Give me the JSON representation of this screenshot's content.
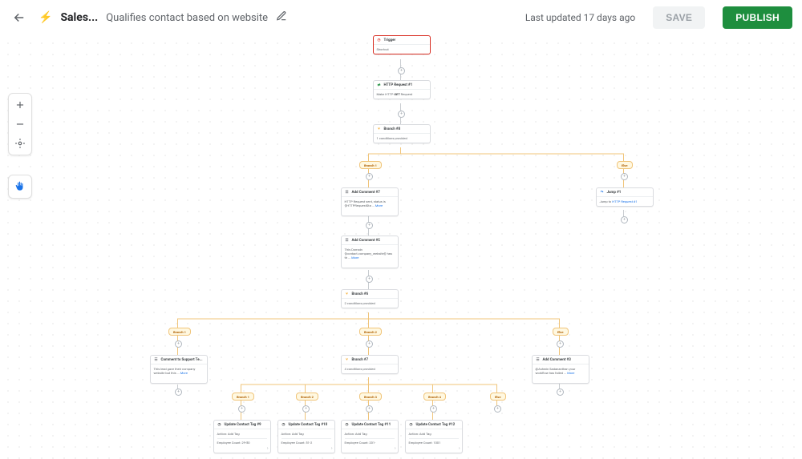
{
  "header": {
    "emoji": "⚡",
    "name": "Sales...",
    "subtitle": "Qualifies contact based on website",
    "updated": "Last updated 17 days ago",
    "save": "SAVE",
    "publish": "PUBLISH"
  },
  "nodes": {
    "trigger": {
      "icon": "◷",
      "title": "Trigger",
      "body": "Shortcut"
    },
    "http1": {
      "icon": "⇄",
      "title": "HTTP Request #1",
      "body_prefix": "Make HTTP ",
      "body_verb": "GET",
      "body_suffix": " Request"
    },
    "branch8": {
      "icon": "⑂",
      "title": "Branch #8",
      "body": "1 conditions provided"
    },
    "addc7": {
      "icon": "☰",
      "title": "Add Comment #7",
      "body": "HTTP Request sent, status is {{HTTPRequestSta ... ",
      "more": "More"
    },
    "addc5": {
      "icon": "☰",
      "title": "Add Comment #5",
      "body": "This Domain {{contact.company_website}} has th ... ",
      "more": "More"
    },
    "branch6": {
      "icon": "⑂",
      "title": "Branch #6",
      "body": "2 conditions provided"
    },
    "jump1": {
      "icon": "↷",
      "title": "Jump #1",
      "body_prefix": "Jump to ",
      "body_link": "HTTP Request #1"
    },
    "supportComment": {
      "icon": "☰",
      "title": "Comment to Support Te...",
      "body": "This lead gave their company website but this ... ",
      "more": "More"
    },
    "branch7": {
      "icon": "⑂",
      "title": "Branch #7",
      "body": "4 conditions provided"
    },
    "addc3": {
      "icon": "☰",
      "title": "Add Comment #3",
      "body": "@Ashwin Sadananthan your workflow has failed ... ",
      "more": "More"
    },
    "tag9": {
      "icon": "◷",
      "title": "Update Contact Tag #9",
      "action": "Action: Add Tag",
      "emp": "Employee Count: 29-50"
    },
    "tag10": {
      "icon": "◷",
      "title": "Update Contact Tag #10",
      "action": "Action: Add Tag",
      "emp": "Employee Count: 51-2"
    },
    "tag11": {
      "icon": "◷",
      "title": "Update Contact Tag #11",
      "action": "Action: Add Tag",
      "emp": "Employee Count: 201-"
    },
    "tag12": {
      "icon": "◷",
      "title": "Update Contact Tag #12",
      "action": "Action: Add Tag",
      "emp": "Employee Count: 1001"
    }
  },
  "pills": {
    "b8_b1": "Branch 1",
    "b8_else": "Else",
    "b6_b1": "Branch 1",
    "b6_b2": "Branch 2",
    "b6_else": "Else",
    "b7_b1": "Branch 1",
    "b7_b2": "Branch 2",
    "b7_b3": "Branch 3",
    "b7_b4": "Branch 4",
    "b7_else": "Else"
  }
}
